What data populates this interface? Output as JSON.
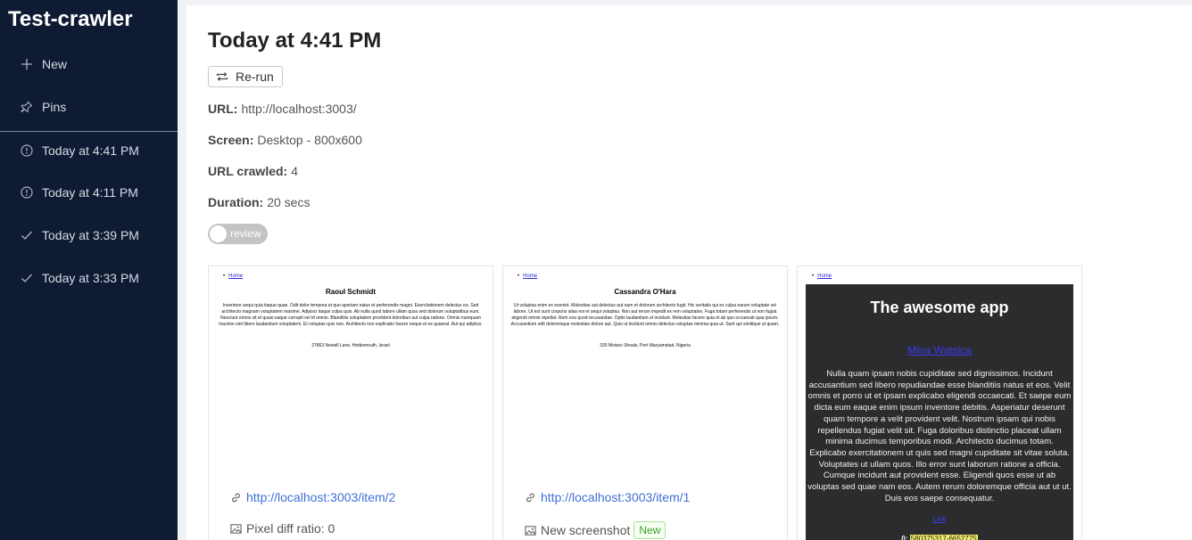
{
  "app": {
    "title": "Test-crawler"
  },
  "sidebar": {
    "actions": [
      {
        "label": "New",
        "icon": "plus-icon"
      },
      {
        "label": "Pins",
        "icon": "pin-icon"
      }
    ],
    "runs": [
      {
        "label": "Today at 4:41 PM",
        "status": "warning",
        "icon": "alert-circle-icon"
      },
      {
        "label": "Today at 4:11 PM",
        "status": "warning",
        "icon": "alert-circle-icon"
      },
      {
        "label": "Today at 3:39 PM",
        "status": "ok",
        "icon": "check-icon"
      },
      {
        "label": "Today at 3:33 PM",
        "status": "ok",
        "icon": "check-icon"
      }
    ]
  },
  "main": {
    "title": "Today at 4:41 PM",
    "rerun_label": "Re-run",
    "info": {
      "url_label": "URL:",
      "url_value": "http://localhost:3003/",
      "screen_label": "Screen:",
      "screen_value": "Desktop - 800x600",
      "crawled_label": "URL crawled:",
      "crawled_value": "4",
      "duration_label": "Duration:",
      "duration_value": "20 secs"
    },
    "review_toggle": {
      "label": "review",
      "on": false
    },
    "cards": [
      {
        "link": "http://localhost:3003/item/2",
        "meta": "Pixel diff ratio: 0",
        "preview": {
          "nav": "Home",
          "title": "Raoul Schmidt",
          "text": "Inventore sequi quia itaque quae. Odit dolor tempora et quo aperiam natus et perferendis magni. Exercitationem delectus ea. Sed architecto magnam voluptatem maxime. Adipisci itaque culpa quis. Ab nulla quod labore ullam quos sed dolorum voluptatibus eum. Nesciunt omnis sit et quasi eaque corrupti vel id omnis. Blanditiis voluptatem provident doloribus aut culpa ratione. Omnis numquam maxime sint libero laudantium voluptatem. Et voluptas quis non. Architecto non explicabo facere neque et ex quaerat. Aut qui adipisci.",
          "address": "27863 Newell Lane, Hettiemouth, Israel"
        }
      },
      {
        "link": "http://localhost:3003/item/1",
        "meta": "New screenshot",
        "badge": "New",
        "preview": {
          "nav": "Home",
          "title": "Cassandra O'Hara",
          "text": "Ut voluptas enim ex eveniet. Molestiae aut delectus aut nam et dolorum architecto fugit. Hic veritatis qui ex culpa earum voluptate vel labore. Ut est sunt corporis alias est et sequi voluptas. Non aut rerum impedit ex rem voluptates. Fuga totam perferendis ut non fugiat eligendi omnis repellat. Rem eos quod recusandae. Optio laudantium et incidunt. Molestias facere quia et ab quo occaecati quia ipsum. Accusantium odit doloremque molestias dolore aut. Quis ut incidunt omnis delectus voluptas minima quia ut. Sunt qui similique ut quam.",
          "address": "335 Moises Shoals, Port Maryamstad, Nigeria"
        }
      },
      {
        "preview": {
          "nav": "Home",
          "app_title": "The awesome app",
          "person_link": "Mina Watsica",
          "text": "Nulla quam ipsam nobis cupiditate sed dignissimos. Incidunt accusantium sed libero repudiandae esse blanditiis natus et eos. Velit omnis et porro ut et ipsam explicabo eligendi occaecati. Et saepe eum dicta eum eaque enim ipsum inventore debitis. Asperiatur deserunt quam tempore a velit provident velit. Nostrum ipsam qui nobis repellendus fugiat velit sit. Fuga doloribus distinctio placeat ullam minima ducimus temporibus modi. Architecto ducimus totam. Explicabo exercitationem ut quis sed magni cupiditate sit vitae soluta. Voluptates ut ullam quos. Illo error sunt laborum ratione a officia. Cumque incidunt aut provident esse. Eligendi quos esse ut ab voluptas sed quae nam eos. Autem rerum doloremque officia aut ut ut. Duis eos saepe consequatur.",
          "small_link": "Link",
          "phone_prefix": "0:",
          "phone": "580375317-6652775"
        }
      }
    ]
  },
  "colors": {
    "sidebar_bg": "#0f1b33",
    "link": "#3f6fd6",
    "badge_green": "#3c9b2c"
  }
}
